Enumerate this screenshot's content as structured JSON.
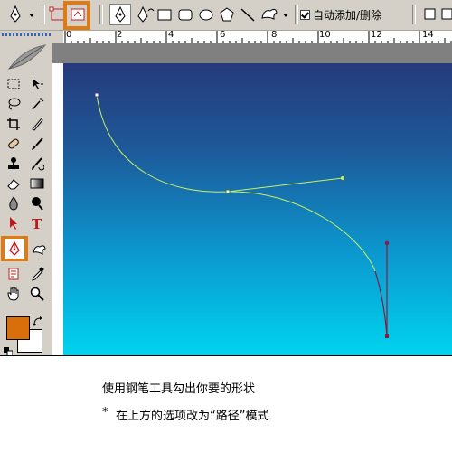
{
  "options_bar": {
    "auto_add_delete_label": "自动添加/删除",
    "auto_add_delete_checked": true,
    "highlight_color": "#e07a12"
  },
  "toolbox": {
    "foreground_color": "#d86f0a",
    "background_color": "#ffffff",
    "tools": [
      "marquee-icon",
      "move-icon",
      "lasso-icon",
      "magic-wand-icon",
      "crop-icon",
      "slice-icon",
      "healing-brush-icon",
      "brush-icon",
      "clone-stamp-icon",
      "history-brush-icon",
      "eraser-icon",
      "gradient-icon",
      "blur-icon",
      "dodge-icon",
      "path-selection-icon",
      "type-icon",
      "pen-icon",
      "custom-shape-icon",
      "notes-icon",
      "eyedropper-icon",
      "hand-icon",
      "zoom-icon"
    ],
    "active_tool": "pen-icon"
  },
  "ruler": {
    "labels": [
      "0",
      "2",
      "4",
      "6",
      "8",
      "10",
      "12",
      "14"
    ]
  },
  "canvas": {
    "gradient_top": "#263a7a",
    "gradient_bottom": "#00d4ef",
    "path_color": "#c8f060",
    "handle_color": "#8a1a3a"
  },
  "caption": {
    "line1": "使用钢笔工具勾出你要的形状",
    "bullet": "*",
    "line2": "在上方的选项改为“路径”模式"
  }
}
